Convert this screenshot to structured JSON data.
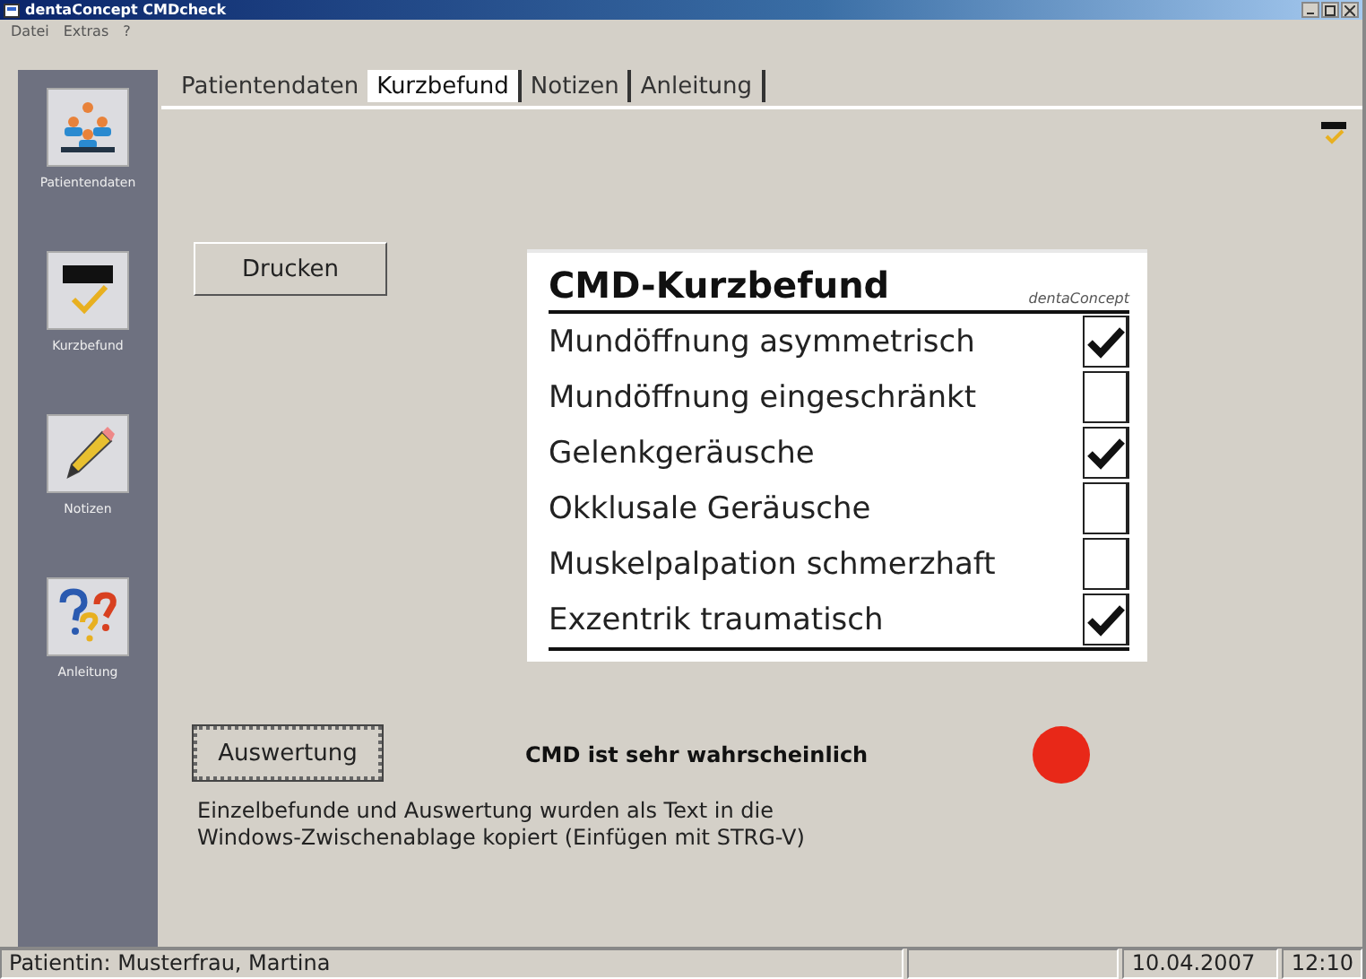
{
  "window": {
    "title": "dentaConcept CMDcheck"
  },
  "menu": [
    "Datei",
    "Extras",
    "?"
  ],
  "sidebar": {
    "items": [
      {
        "kind": "patients",
        "label": "Patientendaten"
      },
      {
        "kind": "cmd",
        "label": "Kurzbefund"
      },
      {
        "kind": "pencil",
        "label": "Notizen"
      },
      {
        "kind": "help",
        "label": "Anleitung"
      }
    ]
  },
  "tabs": [
    {
      "label": "Patientendaten",
      "selected": false
    },
    {
      "label": "Kurzbefund",
      "selected": true
    },
    {
      "label": "Notizen",
      "selected": false
    },
    {
      "label": "Anleitung",
      "selected": false
    }
  ],
  "print_button": "Drucken",
  "card": {
    "title": "CMD-Kurzbefund",
    "brand": "dentaConcept",
    "findings": [
      {
        "label": "Mundöffnung asymmetrisch",
        "checked": true
      },
      {
        "label": "Mundöffnung eingeschränkt",
        "checked": false
      },
      {
        "label": "Gelenkgeräusche",
        "checked": true
      },
      {
        "label": "Okklusale Geräusche",
        "checked": false
      },
      {
        "label": "Muskelpalpation schmerzhaft",
        "checked": false
      },
      {
        "label": "Exzentrik traumatisch",
        "checked": true
      }
    ]
  },
  "evaluate_button": "Auswertung",
  "result": {
    "text": "CMD ist sehr wahrscheinlich",
    "color": "#e82818"
  },
  "message": [
    "Einzelbefunde und Auswertung wurden als Text in die",
    "Windows-Zwischenablage kopiert (Einfügen mit STRG-V)"
  ],
  "status_bar": {
    "patient": "Patientin: Musterfrau, Martina",
    "date": "10.04.2007",
    "time": "12:10"
  }
}
